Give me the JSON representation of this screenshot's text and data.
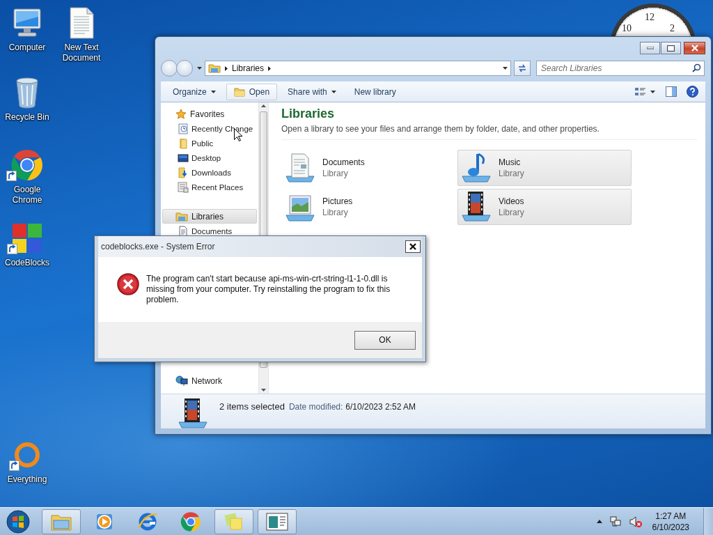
{
  "desktop_icons": [
    {
      "label": "Computer",
      "kind": "computer",
      "shortcut": false
    },
    {
      "label": "New Text Document",
      "kind": "text-file",
      "shortcut": false
    },
    {
      "label": "Recycle Bin",
      "kind": "recycle-bin",
      "shortcut": false
    },
    {
      "label": "Google Chrome",
      "kind": "chrome",
      "shortcut": true
    },
    {
      "label": "CodeBlocks",
      "kind": "codeblocks",
      "shortcut": true
    },
    {
      "label": "Everything",
      "kind": "everything",
      "shortcut": true
    }
  ],
  "clock_gadget": {
    "numerals": [
      "10",
      "12",
      "2"
    ]
  },
  "explorer": {
    "address": {
      "segments": [
        "Libraries"
      ]
    },
    "search": {
      "placeholder": "Search Libraries"
    },
    "toolbar": [
      {
        "label": "Organize",
        "kind": "plain",
        "dropdown": true
      },
      {
        "label": "Open",
        "kind": "folder",
        "dropdown": false
      },
      {
        "label": "Share with",
        "kind": "plain",
        "dropdown": true
      },
      {
        "label": "New library",
        "kind": "plain",
        "dropdown": false
      }
    ],
    "navigation_pane": {
      "groups": [
        {
          "label": "Favorites",
          "kind": "favorites",
          "selected": false,
          "children": [
            {
              "label": "Recently Change",
              "kind": "recent"
            },
            {
              "label": "Public",
              "kind": "folder"
            },
            {
              "label": "Desktop",
              "kind": "desktop"
            },
            {
              "label": "Downloads",
              "kind": "downloads"
            },
            {
              "label": "Recent Places",
              "kind": "places"
            }
          ]
        },
        {
          "label": "Libraries",
          "kind": "libraries",
          "selected": true,
          "children": [
            {
              "label": "Documents",
              "kind": "documents"
            }
          ]
        },
        {
          "label": "Network",
          "kind": "network",
          "selected": false
        }
      ]
    },
    "content": {
      "title": "Libraries",
      "description": "Open a library to see your files and arrange them by folder, date, and other properties.",
      "libraries": [
        {
          "name": "Documents",
          "type": "Library",
          "kind": "documents",
          "selected": false
        },
        {
          "name": "Music",
          "type": "Library",
          "kind": "music",
          "selected": true
        },
        {
          "name": "Pictures",
          "type": "Library",
          "kind": "pictures",
          "selected": false
        },
        {
          "name": "Videos",
          "type": "Library",
          "kind": "videos",
          "selected": true
        }
      ]
    },
    "status_bar": {
      "summary": "2 items selected",
      "field_label": "Date modified:",
      "field_value": "6/10/2023 2:52 AM"
    }
  },
  "error_dialog": {
    "title": "codeblocks.exe - System Error",
    "message": "The program can't start because api-ms-win-crt-string-l1-1-0.dll is missing from your computer. Try reinstalling the program to fix this problem.",
    "buttons": [
      "OK"
    ]
  },
  "taskbar": {
    "apps": [
      {
        "kind": "explorer",
        "active": true
      },
      {
        "kind": "media-player",
        "active": false
      },
      {
        "kind": "ie",
        "active": false
      },
      {
        "kind": "chrome",
        "active": false
      },
      {
        "kind": "sticky-notes",
        "active": true
      },
      {
        "kind": "app-window",
        "active": true
      }
    ],
    "tray": {
      "volume_muted": true
    },
    "clock": {
      "time": "1:27 AM",
      "date": "6/10/2023"
    }
  }
}
